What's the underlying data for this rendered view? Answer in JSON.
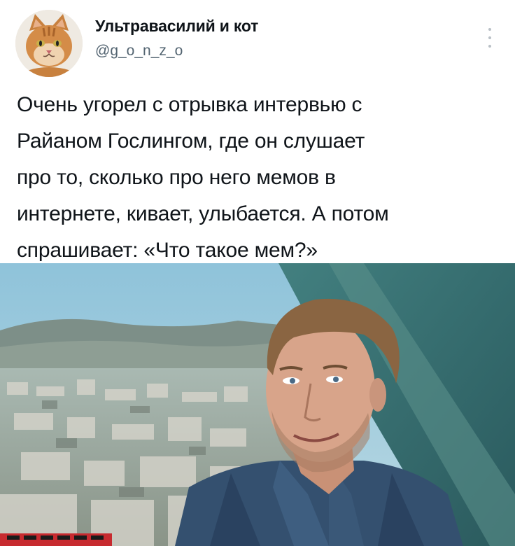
{
  "tweet": {
    "author_name": "Ультравасилий и кот",
    "author_handle": "@g_o_n_z_o",
    "text_lines": [
      "Очень угорел с отрывка интервью с",
      "Райаном Гослингом, где он слушает",
      "про то, сколько про него мемов в",
      "интернете, кивает, улыбается. А потом",
      "спрашивает: «Что такое мем?»"
    ],
    "avatar_icon": "cat-avatar-icon",
    "more_icon": "more-options-icon",
    "media_image": "interview-photo"
  }
}
